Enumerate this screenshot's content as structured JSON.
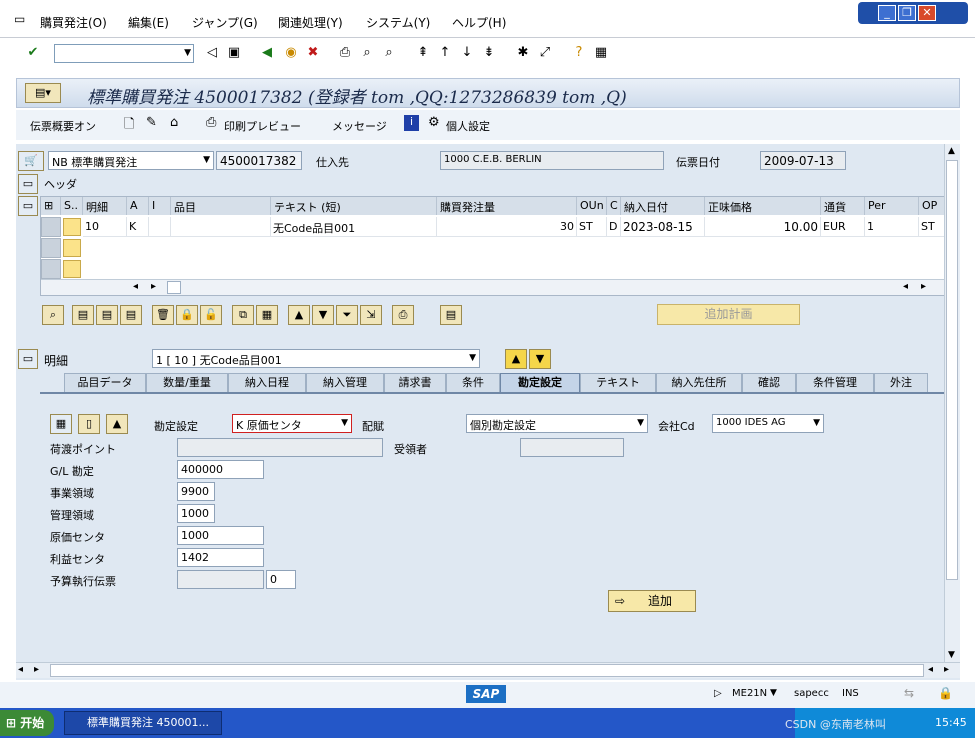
{
  "menu": [
    "購買発注(O)",
    "編集(E)",
    "ジャンプ(G)",
    "関連処理(Y)",
    "システム(Y)",
    "ヘルプ(H)"
  ],
  "window_title": "標準購買発注 4500017382 (登録者 tom ,QQ:1273286839 tom ,Q)",
  "app_toolbar": {
    "doc_overview": "伝票概要オン",
    "print_preview": "印刷プレビュー",
    "messages": "メッセージ",
    "personal_settings": "個人設定"
  },
  "header": {
    "doc_type": "NB 標準購買発注",
    "po_number": "4500017382",
    "vendor_label": "仕入先",
    "vendor_value": "1000 C.E.B. BERLIN",
    "doc_date_label": "伝票日付",
    "doc_date_value": "2009-07-13",
    "header_label": "ヘッダ"
  },
  "items_table": {
    "columns": [
      "S..",
      "明細",
      "A",
      "I",
      "品目",
      "テキスト (短)",
      "購買発注量",
      "OUn",
      "C",
      "納入日付",
      "正味価格",
      "通貨",
      "Per",
      "OP"
    ],
    "rows": [
      {
        "item": "10",
        "a": "K",
        "i": "",
        "material": "",
        "text": "无Code品目001",
        "qty": "30",
        "oun": "ST",
        "c": "D",
        "date": "2023-08-15",
        "price": "10.00",
        "curr": "EUR",
        "per": "1",
        "op": "ST"
      }
    ]
  },
  "planned_button": "追加計画",
  "detail": {
    "label": "明細",
    "item_select": "1 [ 10 ] 无Code品目001",
    "tabs": [
      "品目データ",
      "数量/重量",
      "納入日程",
      "納入管理",
      "請求書",
      "条件",
      "勘定設定",
      "テキスト",
      "納入先住所",
      "確認",
      "条件管理",
      "外注"
    ],
    "active_tab": "勘定設定"
  },
  "account": {
    "acct_assign_label": "勘定設定",
    "acct_assign_value": "K 原価センタ",
    "distribution_label": "配賦",
    "distribution_value": "個別勘定設定",
    "company_label": "会社Cd",
    "company_value": "1000 IDES AG",
    "unloading_label": "荷渡ポイント",
    "recipient_label": "受領者",
    "gl_label": "G/L 勘定",
    "gl_value": "400000",
    "business_area_label": "事業領域",
    "business_area_value": "9900",
    "co_area_label": "管理領域",
    "co_area_value": "1000",
    "cost_center_label": "原価センタ",
    "cost_center_value": "1000",
    "profit_center_label": "利益センタ",
    "profit_center_value": "1402",
    "budget_label": "予算執行伝票",
    "budget_value": "0",
    "add_button": "追加"
  },
  "status": {
    "tcode": "ME21N",
    "server": "sapecc",
    "mode": "INS",
    "logo": "SAP"
  },
  "taskbar": {
    "start": "开始",
    "task": "標準購買発注 450001...",
    "time": "15:45",
    "watermark": "CSDN @东南老林叫"
  }
}
